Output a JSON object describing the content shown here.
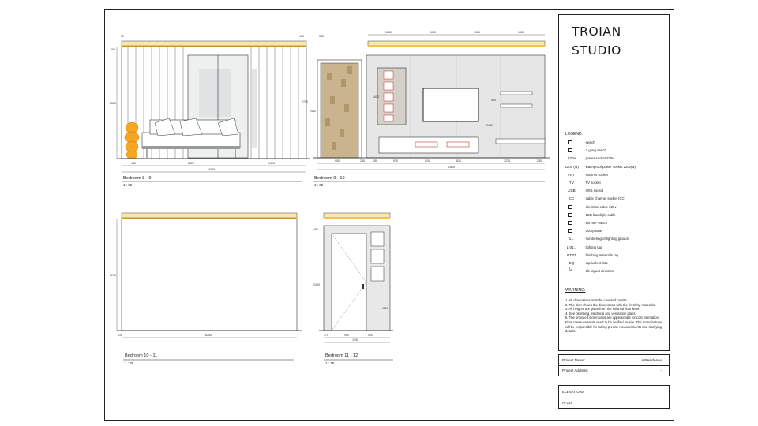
{
  "studio": {
    "line1": "TROIAN",
    "line2": "STUDIO"
  },
  "views": {
    "v1": {
      "title": "Bedroom 8 - 9",
      "scale": "1 : 35"
    },
    "v2": {
      "title": "Bedroom 9 - 10",
      "scale": "1 : 35"
    },
    "v3": {
      "title": "Bedroom 10 - 11",
      "scale": "1 : 35"
    },
    "v4": {
      "title": "Bedroom 11 - 12",
      "scale": "1 : 35"
    }
  },
  "dims": {
    "v1_top_l": "50",
    "v1_top_r": "100",
    "v1_left_top": "260",
    "v1_left_h": "2535",
    "v1_b1": "462",
    "v1_b2": "2520",
    "v1_b3": "1413",
    "v1_total": "4395",
    "v2_top": "335",
    "v2_top1": "1080",
    "v2_top2": "1080",
    "v2_top3": "1080",
    "v2_top4": "1080",
    "v2_h1": "2440",
    "v2_h2": "2700",
    "v2_h3": "1450",
    "v2_h4": "400",
    "v2_b1": "900",
    "v2_b2": "265",
    "v2_b3": "150",
    "v2_b4": "910",
    "v2_b5": "910",
    "v2_b6": "810",
    "v2_b7": "1275",
    "v2_b8": "230",
    "v2_b9": "2805",
    "v2_b10": "2140",
    "v3_h": "2760",
    "v3_bl": "20",
    "v3_total": "6255",
    "v4_top": "460",
    "v4_h": "2300",
    "v4_b1": "170",
    "v4_b2": "900",
    "v4_b3": "420",
    "v4_total": "1390",
    "v4_h2": "1100"
  },
  "legend": {
    "title": "LEGEND:",
    "items": [
      {
        "code": "",
        "symbol": "box",
        "text": "- switch"
      },
      {
        "code": "",
        "symbol": "box",
        "text": "- 2 gang switch"
      },
      {
        "code": "220v",
        "symbol": "",
        "text": "- power socket 220v"
      },
      {
        "code": "220v (w)",
        "symbol": "",
        "text": "- waterproof power socket 220v(w)"
      },
      {
        "code": "INT",
        "symbol": "",
        "text": "- Internet socket"
      },
      {
        "code": "TV",
        "symbol": "",
        "text": "- TV socket"
      },
      {
        "code": "USB",
        "symbol": "",
        "text": "- USB socket"
      },
      {
        "code": "CC",
        "symbol": "",
        "text": "- cable channel socket (CC)"
      },
      {
        "code": "",
        "symbol": "box",
        "text": "- electrical cable 220v"
      },
      {
        "code": "",
        "symbol": "line",
        "text": "- LED backlight cable"
      },
      {
        "code": "",
        "symbol": "box",
        "text": "- dimmer switch"
      },
      {
        "code": "",
        "symbol": "box",
        "text": "- doorphone"
      },
      {
        "code": "1...",
        "symbol": "",
        "text": "- numbering of lighting groups"
      },
      {
        "code": "L.01...",
        "symbol": "",
        "text": "- lighting tag"
      },
      {
        "code": "PT.01",
        "symbol": "",
        "text": "- finishing materials tag"
      },
      {
        "code": "EQ",
        "symbol": "",
        "text": "- equivalent size"
      },
      {
        "code": "",
        "symbol": "arrow",
        "text": "- tile layout direction"
      }
    ]
  },
  "warning": {
    "title": "WARNING:",
    "lines": [
      "1. All dimensions must be checked on site.",
      "2. The plan shows the dimensions with the finishing materials.",
      "3. All heights are given from the finished floor level.",
      "4. See plumbing, electrical and ventilation plans.",
      "5. The provided dimensions are approximate for cost estimation. Final measurements need to be verified on-site. The manufacturer will be responsible for taking precise measurements and clarifying details."
    ]
  },
  "project": {
    "name_label": "Project Name:",
    "name_value": "A Residence",
    "address_label": "Project Address:",
    "address_value": "-"
  },
  "sheet": {
    "title": "ELEVATIONS",
    "number": "A -129"
  },
  "colors": {
    "led": "#f3d36a",
    "vase": "#f5a623",
    "wall": "#e6e6e6",
    "wood": "#c79a6a",
    "accent_red": "#c0392b"
  }
}
